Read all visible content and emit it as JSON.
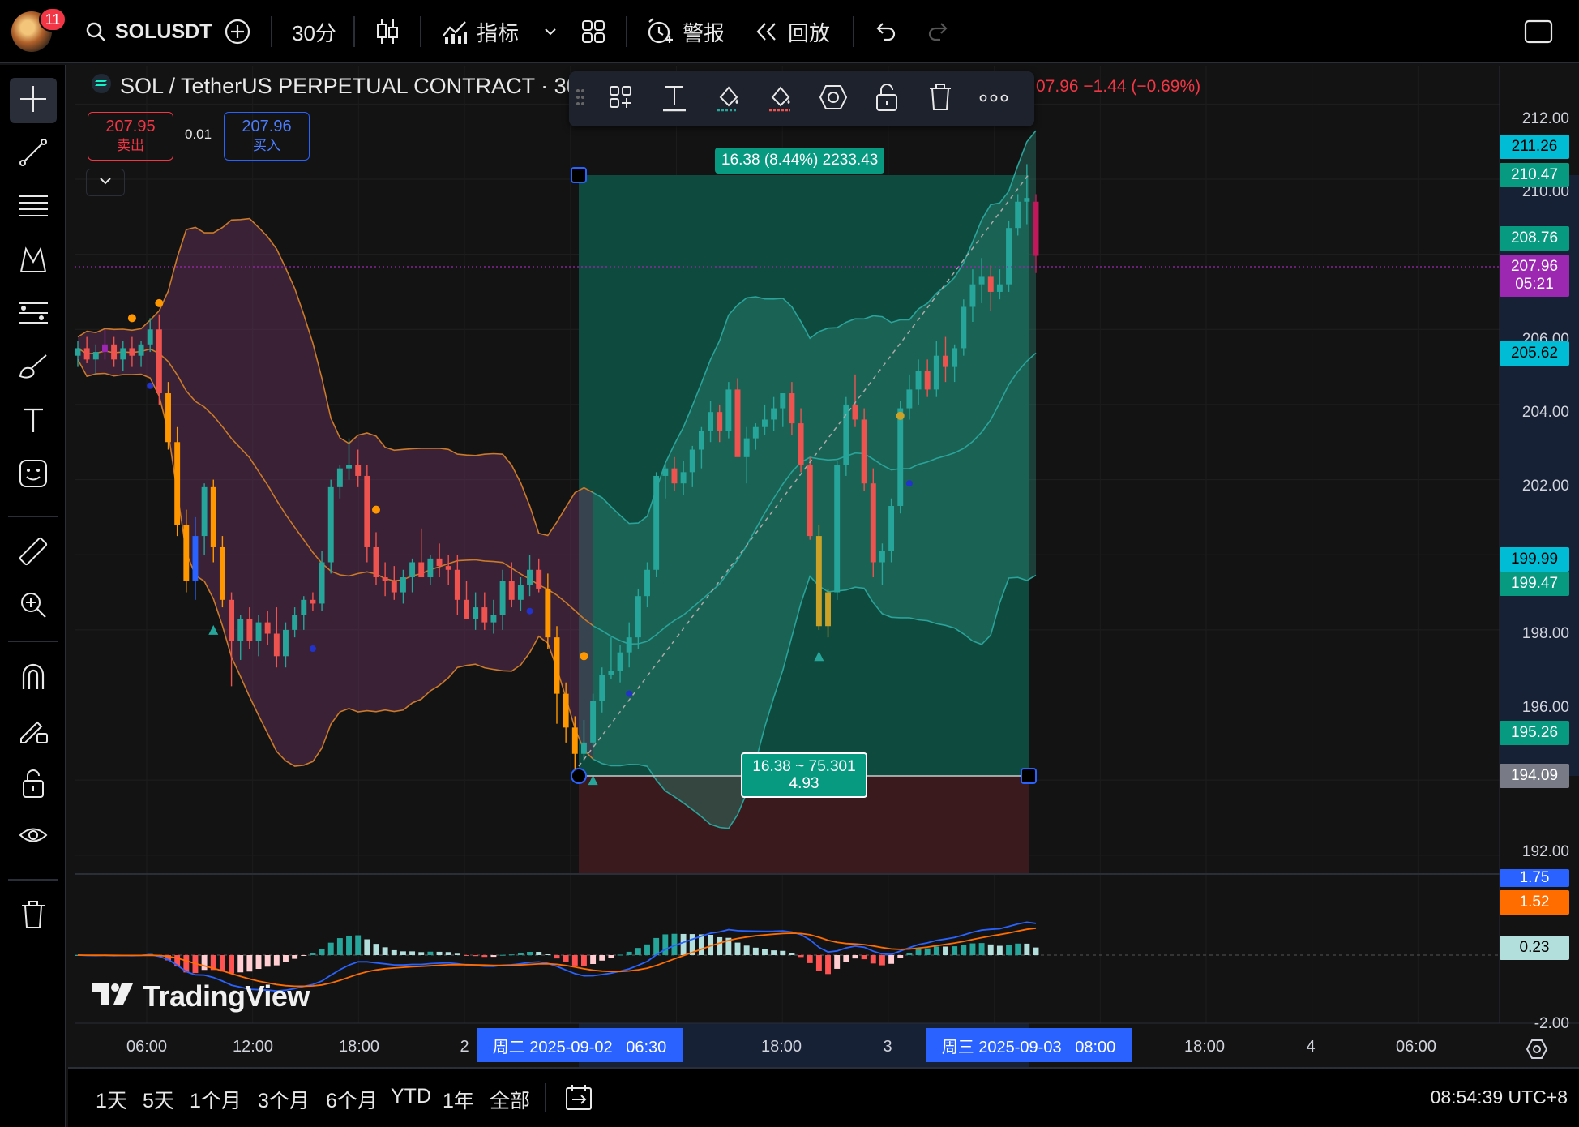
{
  "topbar": {
    "notifications": "11",
    "symbol": "SOLUSDT",
    "interval": "30分",
    "indicators_label": "指标",
    "alert_label": "警报",
    "replay_label": "回放"
  },
  "legend": {
    "title": "SOL / TetherUS PERPETUAL CONTRACT · 30 ·",
    "quote": "07.96 −1.44 (−0.69%)",
    "sell_price": "207.95",
    "sell_label": "卖出",
    "spread": "0.01",
    "buy_price": "207.96",
    "buy_label": "买入"
  },
  "position_tool": {
    "target_label": "16.38 (8.44%) 2233.43",
    "stats_line1": "16.38 ~ 75.301",
    "stats_line2": "4.93"
  },
  "price_scale": {
    "labels": [
      "212.00",
      "210.00",
      "206.00",
      "204.00",
      "202.00",
      "198.00",
      "196.00",
      "192.00"
    ],
    "tags": {
      "t21126": "211.26",
      "t21047": "210.47",
      "t20876": "208.76",
      "last_price": "207.96",
      "countdown": "05:21",
      "t20562": "205.62",
      "t19999": "199.99",
      "t19947": "199.47",
      "t19526": "195.26",
      "t19409": "194.09"
    },
    "macd_tags": {
      "macd": "1.75",
      "signal": "1.52",
      "hist": "0.23"
    },
    "macd_labels": [
      "-2.00"
    ]
  },
  "time_axis": {
    "labels": [
      "06:00",
      "12:00",
      "18:00",
      "2",
      "18:00",
      "3",
      "18:00",
      "4",
      "06:00"
    ],
    "crosshair_start": "周二 2025-09-02   06:30",
    "crosshair_end": "周三 2025-09-03   08:00"
  },
  "bottombar": {
    "ranges": [
      "1天",
      "5天",
      "1个月",
      "3个月",
      "6个月",
      "YTD",
      "1年",
      "全部"
    ],
    "clock": "08:54:39 UTC+8"
  },
  "watermark": "TradingView",
  "colors": {
    "up": "#26a69a",
    "down": "#ef5350",
    "orange": "#ff9800",
    "purple": "#9c27b0",
    "accent": "#2962ff",
    "profit_zone": "#0f4d40",
    "loss_zone": "#3a1a1d"
  },
  "chart_data": {
    "type": "candlestick",
    "symbol": "SOL / TetherUS PERPETUAL CONTRACT",
    "interval": "30",
    "ylim": [
      191.5,
      213
    ],
    "candles": [
      [
        205.3,
        205.7,
        205.0,
        205.5
      ],
      [
        205.5,
        205.8,
        205.1,
        205.2
      ],
      [
        205.2,
        205.6,
        204.8,
        205.4
      ],
      [
        205.4,
        206.0,
        205.2,
        205.6
      ],
      [
        205.6,
        205.8,
        205.0,
        205.2
      ],
      [
        205.2,
        205.7,
        204.9,
        205.5
      ],
      [
        205.5,
        205.8,
        205.0,
        205.3
      ],
      [
        205.3,
        205.7,
        205.0,
        205.6
      ],
      [
        205.6,
        206.3,
        205.4,
        206.0
      ],
      [
        206.0,
        206.4,
        204.0,
        204.3
      ],
      [
        204.3,
        204.6,
        202.8,
        203.0
      ],
      [
        203.0,
        203.4,
        200.5,
        200.8
      ],
      [
        200.8,
        201.2,
        199.0,
        199.3
      ],
      [
        199.3,
        201.0,
        198.8,
        200.5
      ],
      [
        200.5,
        201.9,
        200.0,
        201.8
      ],
      [
        201.8,
        202.0,
        199.8,
        200.2
      ],
      [
        200.2,
        200.5,
        198.6,
        198.8
      ],
      [
        198.8,
        199.0,
        196.5,
        197.7
      ],
      [
        197.7,
        198.4,
        197.2,
        198.3
      ],
      [
        198.3,
        198.6,
        197.5,
        197.7
      ],
      [
        197.7,
        198.4,
        197.3,
        198.2
      ],
      [
        198.2,
        198.5,
        197.6,
        197.9
      ],
      [
        197.9,
        198.6,
        197.0,
        197.3
      ],
      [
        197.3,
        198.2,
        197.0,
        198.0
      ],
      [
        198.0,
        198.6,
        197.8,
        198.4
      ],
      [
        198.4,
        198.9,
        198.0,
        198.8
      ],
      [
        198.8,
        199.0,
        198.5,
        198.7
      ],
      [
        198.7,
        200.1,
        198.5,
        199.8
      ],
      [
        199.8,
        202.0,
        199.5,
        201.8
      ],
      [
        201.8,
        202.4,
        201.5,
        202.3
      ],
      [
        202.3,
        203.1,
        202.0,
        202.4
      ],
      [
        202.4,
        202.8,
        201.8,
        202.1
      ],
      [
        202.1,
        202.4,
        199.8,
        200.2
      ],
      [
        200.2,
        200.6,
        199.2,
        199.4
      ],
      [
        199.4,
        199.8,
        198.9,
        199.3
      ],
      [
        199.3,
        199.7,
        198.8,
        199.0
      ],
      [
        199.0,
        199.6,
        198.7,
        199.4
      ],
      [
        199.4,
        199.9,
        199.0,
        199.8
      ],
      [
        199.8,
        200.7,
        199.5,
        199.4
      ],
      [
        199.4,
        200.0,
        199.2,
        199.9
      ],
      [
        199.9,
        200.3,
        199.4,
        199.7
      ],
      [
        199.7,
        200.0,
        199.2,
        199.6
      ],
      [
        199.6,
        200.0,
        198.4,
        198.8
      ],
      [
        198.8,
        199.3,
        198.3,
        198.3
      ],
      [
        198.3,
        199.0,
        198.0,
        198.6
      ],
      [
        198.6,
        199.0,
        198.0,
        198.2
      ],
      [
        198.2,
        198.8,
        197.9,
        198.4
      ],
      [
        198.4,
        199.6,
        198.0,
        199.3
      ],
      [
        199.3,
        199.8,
        198.6,
        198.8
      ],
      [
        198.8,
        199.4,
        198.5,
        199.2
      ],
      [
        199.2,
        200.0,
        198.9,
        199.6
      ],
      [
        199.6,
        199.9,
        199.0,
        199.1
      ],
      [
        199.1,
        199.5,
        197.5,
        197.8
      ],
      [
        197.8,
        198.1,
        195.5,
        196.3
      ],
      [
        196.3,
        196.6,
        195.0,
        195.4
      ],
      [
        195.4,
        195.7,
        194.3,
        194.7
      ],
      [
        194.7,
        195.6,
        194.5,
        195.0
      ],
      [
        195.0,
        196.3,
        194.9,
        196.1
      ],
      [
        196.1,
        197.0,
        195.8,
        196.8
      ],
      [
        196.8,
        197.8,
        196.7,
        196.9
      ],
      [
        196.9,
        197.6,
        196.6,
        197.4
      ],
      [
        197.4,
        198.2,
        197.0,
        197.8
      ],
      [
        197.8,
        199.1,
        197.5,
        198.9
      ],
      [
        198.9,
        199.8,
        198.6,
        199.6
      ],
      [
        199.6,
        202.2,
        199.4,
        202.1
      ],
      [
        202.1,
        202.5,
        201.5,
        202.3
      ],
      [
        202.3,
        202.6,
        201.7,
        201.9
      ],
      [
        201.9,
        202.5,
        201.6,
        202.2
      ],
      [
        202.2,
        202.9,
        201.8,
        202.8
      ],
      [
        202.8,
        203.4,
        202.3,
        203.3
      ],
      [
        203.3,
        204.1,
        203.0,
        203.8
      ],
      [
        203.8,
        204.0,
        203.0,
        203.3
      ],
      [
        203.3,
        204.6,
        203.1,
        204.4
      ],
      [
        204.4,
        204.7,
        202.9,
        202.6
      ],
      [
        202.6,
        203.4,
        201.9,
        203.1
      ],
      [
        203.1,
        203.5,
        202.8,
        203.4
      ],
      [
        203.4,
        204.0,
        203.2,
        203.6
      ],
      [
        203.6,
        204.2,
        203.3,
        203.9
      ],
      [
        203.9,
        204.3,
        203.4,
        204.3
      ],
      [
        204.3,
        204.6,
        203.2,
        203.5
      ],
      [
        203.5,
        203.9,
        202.2,
        202.4
      ],
      [
        202.4,
        202.6,
        200.4,
        200.5
      ],
      [
        200.5,
        200.8,
        198.0,
        198.1
      ],
      [
        198.1,
        199.1,
        197.8,
        199.0
      ],
      [
        199.0,
        202.5,
        198.8,
        202.4
      ],
      [
        202.4,
        204.2,
        202.1,
        204.0
      ],
      [
        204.0,
        204.8,
        203.4,
        203.6
      ],
      [
        203.6,
        203.9,
        201.7,
        201.9
      ],
      [
        201.9,
        202.3,
        199.4,
        199.8
      ],
      [
        199.8,
        200.3,
        199.2,
        200.1
      ],
      [
        200.1,
        201.5,
        199.8,
        201.3
      ],
      [
        201.3,
        204.1,
        201.1,
        203.9
      ],
      [
        203.9,
        204.8,
        203.6,
        204.4
      ],
      [
        204.4,
        205.2,
        204.0,
        204.9
      ],
      [
        204.9,
        205.2,
        204.2,
        204.4
      ],
      [
        204.4,
        205.7,
        204.2,
        205.3
      ],
      [
        205.3,
        205.8,
        204.6,
        205.0
      ],
      [
        205.0,
        205.6,
        204.6,
        205.5
      ],
      [
        205.5,
        206.8,
        205.3,
        206.6
      ],
      [
        206.6,
        207.6,
        206.2,
        207.2
      ],
      [
        207.2,
        207.9,
        206.7,
        207.4
      ],
      [
        207.4,
        207.7,
        206.5,
        207.0
      ],
      [
        207.0,
        207.6,
        206.8,
        207.2
      ],
      [
        207.2,
        208.9,
        207.0,
        208.7
      ],
      [
        208.7,
        209.6,
        208.5,
        209.4
      ],
      [
        209.4,
        210.4,
        208.8,
        209.5
      ],
      [
        209.4,
        209.6,
        207.5,
        207.96
      ]
    ],
    "position_tool": {
      "entry": 194.09,
      "target": 210.47,
      "stop": 191.5,
      "target_text": "16.38 (8.44%) 2233.43",
      "stats": "16.38 ~ 75.301 / 4.93"
    },
    "macd": {
      "macd": 1.75,
      "signal": 1.52,
      "histogram": 0.23
    }
  }
}
